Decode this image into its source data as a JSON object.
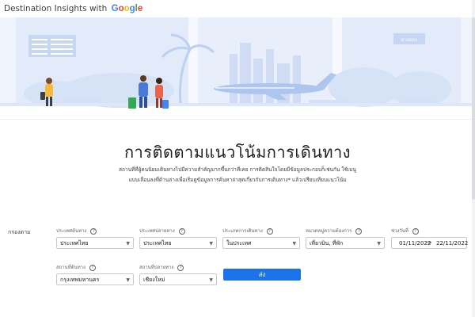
{
  "header": {
    "title": "Destination Insights with",
    "logo_text": "Google"
  },
  "hero": {
    "sign_text": "ทางออก"
  },
  "main": {
    "title": "การติดตามแนวโน้มการเดินทาง",
    "subtitle": "สถานที่ที่ผู้คนนิยมเดินทางไปมีความสำคัญมากขึ้นกว่าที่เคย การติดสินใจโดยมีข้อมูลประกอบก็เช่นกัน ใช้เมนูแบบเลื่อนลงที่ด้านล่างเพื่อเริ่มดูข้อมูลการค้นหาล่าสุดเกี่ยวกับการเดินทาง* แล้วเปรียบเทียบแนวโน้ม"
  },
  "filters": {
    "heading": "กรองตาม",
    "origin_country": {
      "label": "ประเทศต้นทาง",
      "value": "ประเทศไทย"
    },
    "destination_country": {
      "label": "ประเทศปลายทาง",
      "value": "ประเทศไทย"
    },
    "trip_type": {
      "label": "ประเภทการเดินทาง",
      "value": "ในประเทศ"
    },
    "category": {
      "label": "หมวดหมู่ความต้องการ",
      "value": "เที่ยวบิน, ที่พัก"
    },
    "date_range": {
      "label": "ช่วงวันที่",
      "start": "01/11/2022",
      "end": "22/11/2022"
    },
    "origin_place": {
      "label": "สถานที่ต้นทาง",
      "value": "กรุงเทพมหานคร"
    },
    "destination_place": {
      "label": "สถานที่ปลายทาง",
      "value": "เชียงใหม่"
    },
    "submit_label": "ส่ง"
  },
  "colors": {
    "accent": "#1a73e8",
    "hero_bg": "#e8effb",
    "hero_mid": "#c6d6f3"
  }
}
